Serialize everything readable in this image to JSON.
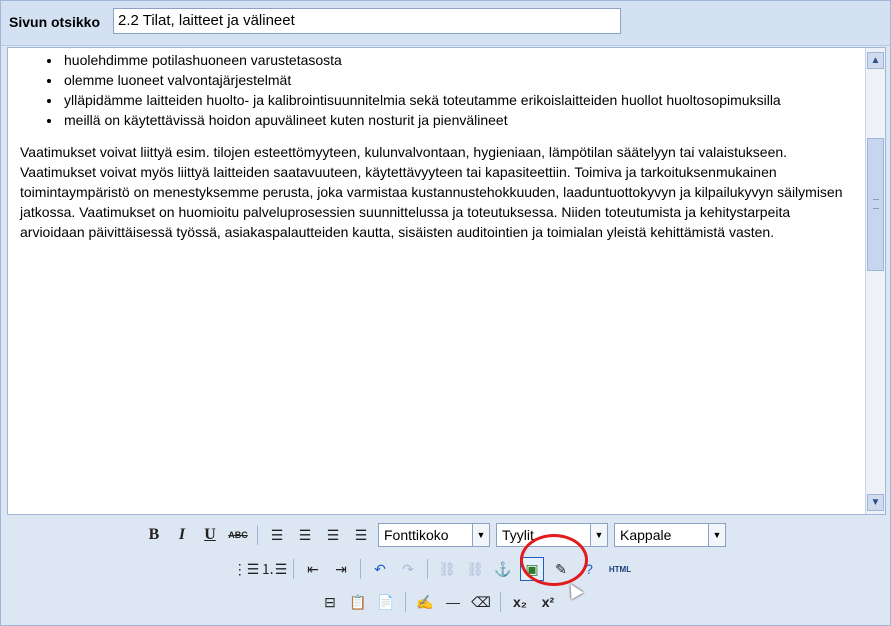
{
  "title": {
    "label": "Sivun otsikko",
    "value": "2.2 Tilat, laitteet ja välineet"
  },
  "content": {
    "bullets": [
      "huolehdimme potilashuoneen varustetasosta",
      "olemme luoneet valvontajärjestelmät",
      "ylläpidämme laitteiden huolto- ja kalibrointisuunnitelmia sekä toteutamme erikoislaitteiden huollot huoltosopimuksilla",
      "meillä on käytettävissä hoidon apuvälineet kuten nosturit ja pienvälineet"
    ],
    "paragraph": "Vaatimukset voivat liittyä esim. tilojen esteettömyyteen, kulunvalvontaan, hygieniaan, lämpötilan säätelyyn tai valaistukseen. Vaatimukset voivat myös liittyä laitteiden saatavuuteen, käytettävyyteen tai kapasiteettiin. Toimiva ja tarkoituksenmukainen toimintaympäristö on menestyksemme perusta, joka varmistaa kustannustehokkuuden, laaduntuottokyvyn ja kilpailukyvyn säilymisen jatkossa. Vaatimukset on huomioitu palveluprosessien suunnittelussa ja toteutuksessa. Niiden toteutumista ja kehitystarpeita arvioidaan päivittäisessä työssä, asiakaspalautteiden kautta, sisäisten auditointien ja toimialan yleistä kehittämistä vasten."
  },
  "toolbar": {
    "bold": "B",
    "italic": "I",
    "underline": "U",
    "strike": "ABC",
    "font_size": "Fonttikoko",
    "style": "Tyylit",
    "format": "Kappale",
    "html": "HTML",
    "subscript": "x₂",
    "superscript": "x²"
  },
  "colors": {
    "highlight": "#e21b1b",
    "accent": "#1a3f7a"
  }
}
